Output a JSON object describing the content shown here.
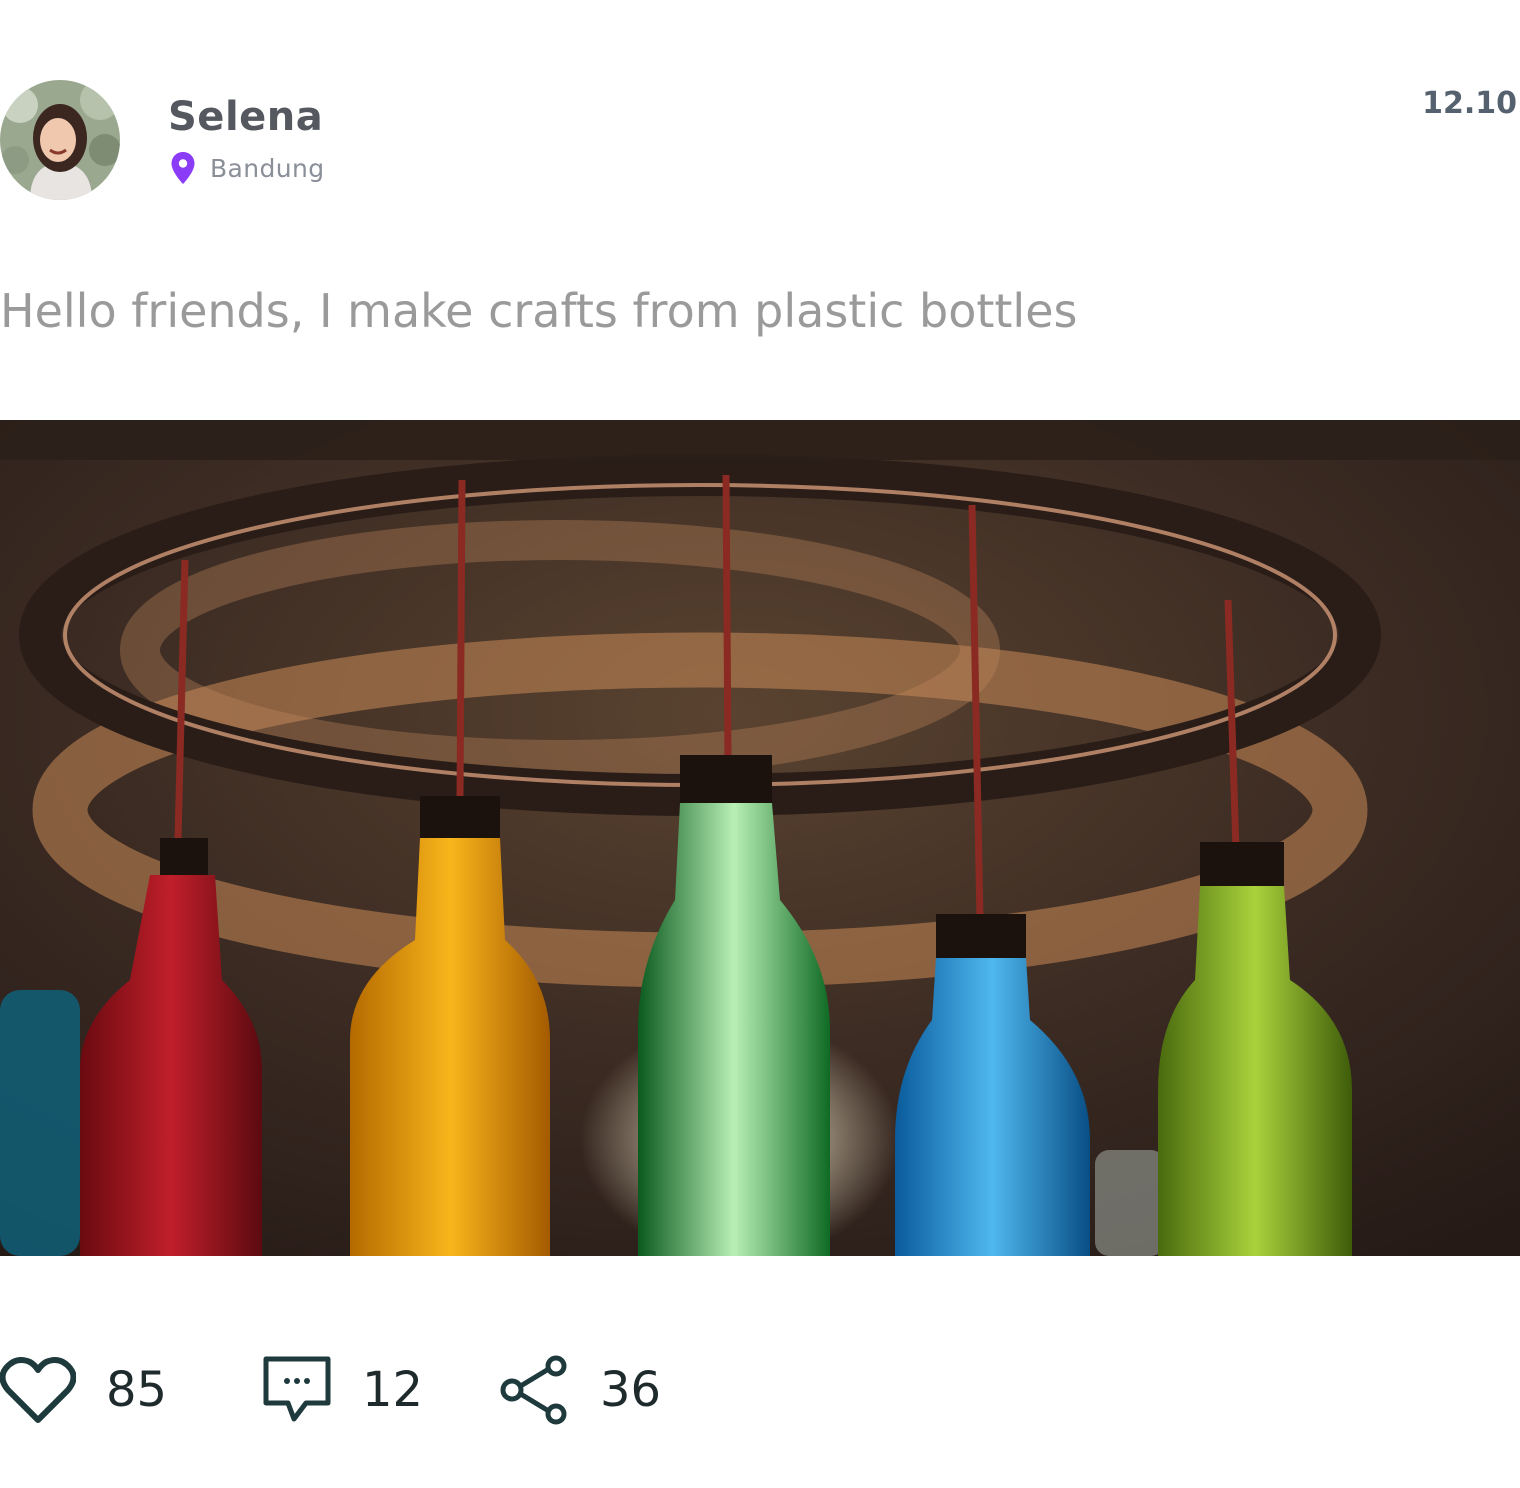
{
  "post": {
    "author": {
      "name": "Selena",
      "location": "Bandung",
      "avatar_icon": "avatar-photo"
    },
    "time": "12.10",
    "caption": "Hello friends, I make crafts from plastic bottles",
    "image_alt": "Chandelier made of colorful plastic bottles hanging from a metal ring",
    "stats": {
      "likes": "85",
      "comments": "12",
      "shares": "36"
    }
  },
  "colors": {
    "location_pin": "#8b3cf7",
    "icon_stroke": "#1e3a3c",
    "username": "#55585f"
  }
}
